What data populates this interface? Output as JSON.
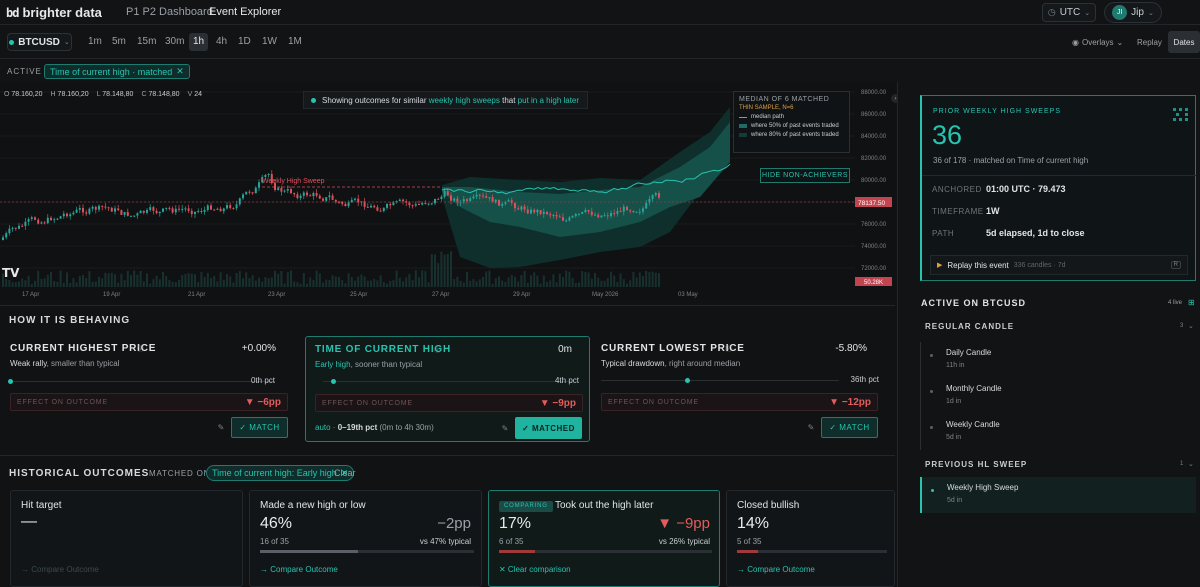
{
  "app": {
    "logo_mark": "bd",
    "name": "brighter data"
  },
  "nav": {
    "tabs": [
      {
        "label": "P1 P2 Dashboard"
      },
      {
        "label": "Event Explorer"
      }
    ],
    "timezone": "UTC",
    "user_initials": "JI",
    "user_name": "Jip"
  },
  "toolbar": {
    "symbol": "BTCUSD",
    "timeframes": [
      "1m",
      "5m",
      "15m",
      "30m",
      "1h",
      "4h",
      "1D",
      "1W",
      "1M"
    ],
    "active_timeframe": "1h",
    "overlays": "Overlays",
    "replay": "Replay",
    "dates": "Dates"
  },
  "active_bar": {
    "label": "ACTIVE",
    "tag": "Time of current high · matched"
  },
  "chart": {
    "ohlc": {
      "O": "78.160,20",
      "H": "78.160,20",
      "L": "78.148,80",
      "C": "78.148,80",
      "V": "24"
    },
    "banner_prefix": "Showing outcomes for similar ",
    "banner_hl1": "weekly high sweeps",
    "banner_mid": " that ",
    "banner_hl2": "put in a high later",
    "sweep_label": "Weekly High Sweep",
    "legend_title": "MEDIAN OF 6 MATCHED",
    "legend_warn": "THIN SAMPLE, N=6",
    "legend_items": [
      "median path",
      "where 50% of past events traded",
      "where 80% of past events traded"
    ],
    "hide_btn": "HIDE NON-ACHIEVERS",
    "watermark": "TV",
    "price_labels": [
      "88000.00",
      "86000.00",
      "84000.00",
      "82000.00",
      "80000.00",
      "78000.00",
      "76000.00",
      "74000.00",
      "72000.00"
    ],
    "current_price": "78137.50",
    "volume_label": "50.28K",
    "date_labels": [
      "17 Apr",
      "19 Apr",
      "21 Apr",
      "23 Apr",
      "25 Apr",
      "27 Apr",
      "29 Apr",
      "May 2026",
      "03 May"
    ],
    "colors": {
      "up": "#26a69a",
      "down": "#e0505a",
      "accent": "#27c4b0"
    }
  },
  "behaving": {
    "title": "HOW IT IS BEHAVING",
    "cards": [
      {
        "title": "CURRENT HIGHEST PRICE",
        "value": "+0.00%",
        "sub_strong": "Weak rally",
        "sub_rest": ", smaller than typical",
        "pct": "0th pct",
        "effect_label": "EFFECT ON OUTCOME",
        "effect": "▼ −6pp",
        "action": "✓ MATCH",
        "level": 0.0
      },
      {
        "title": "TIME OF CURRENT HIGH",
        "value": "0m",
        "sub_strong": "Early high",
        "sub_rest": ", sooner than typical",
        "pct": "4th pct",
        "effect_label": "EFFECT ON OUTCOME",
        "effect": "▼ −9pp",
        "action": "✓ MATCHED",
        "auto": "auto",
        "range": "0–19th pct",
        "range_note": "(0m to 4h 30m)",
        "level": 0.04
      },
      {
        "title": "CURRENT LOWEST PRICE",
        "value": "-5.80%",
        "sub_strong": "Typical drawdown",
        "sub_rest": ", right around median",
        "pct": "36th pct",
        "effect_label": "EFFECT ON OUTCOME",
        "effect": "▼ −12pp",
        "action": "✓ MATCH",
        "level": 0.36
      }
    ]
  },
  "historical": {
    "title": "HISTORICAL OUTCOMES",
    "matched_on": "MATCHED ON",
    "filter": "Time of current high: Early high",
    "clear": "Clear",
    "cards": [
      {
        "title": "Hit target",
        "value": "—",
        "link": "→ Compare Outcome"
      },
      {
        "title": "Made a new high or low",
        "value": "46%",
        "count": "16 of 35",
        "delta": "−2pp",
        "vs": "vs 47% typical",
        "link": "→ Compare Outcome",
        "fill": 0.46
      },
      {
        "title": "Took out the high later",
        "badge": "COMPARING",
        "value": "17%",
        "count": "6 of 35",
        "delta": "▼ −9pp",
        "vs": "vs 26% typical",
        "link": "✕ Clear comparison",
        "fill": 0.17
      },
      {
        "title": "Closed bullish",
        "value": "14%",
        "count": "5 of 35",
        "link": "→ Compare Outcome",
        "fill": 0.14
      }
    ]
  },
  "side": {
    "card": {
      "title": "PRIOR WEEKLY HIGH SWEEPS",
      "count": "36",
      "sub": "36 of 178 · matched on Time of current high",
      "rows": [
        {
          "k": "ANCHORED",
          "v": "01:00 UTC · 79.473"
        },
        {
          "k": "TIMEFRAME",
          "v": "1W"
        },
        {
          "k": "PATH",
          "v": "5d elapsed, 1d to close"
        }
      ],
      "replay": "Replay this event",
      "replay_meta": "336 candles · 7d",
      "replay_key": "R"
    },
    "active_title": "ACTIVE ON BTCUSD",
    "active_count": "4 live",
    "groups": [
      {
        "title": "REGULAR CANDLE",
        "count": "3",
        "items": [
          {
            "name": "Daily Candle",
            "sub": "11h in"
          },
          {
            "name": "Monthly Candle",
            "sub": "1d in"
          },
          {
            "name": "Weekly Candle",
            "sub": "5d in"
          }
        ]
      },
      {
        "title": "PREVIOUS HL SWEEP",
        "count": "1",
        "items": [
          {
            "name": "Weekly High Sweep",
            "sub": "5d in"
          }
        ]
      }
    ]
  }
}
